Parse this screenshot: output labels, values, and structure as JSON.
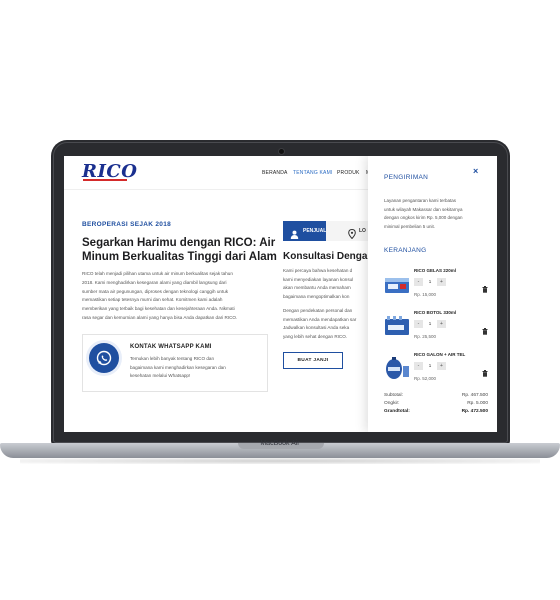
{
  "device": {
    "label": "MacBook Air"
  },
  "site": {
    "logo": "RICO",
    "nav": [
      "BERANDA",
      "TENTANG KAMI",
      "PRODUK",
      "M"
    ],
    "active_nav": 1
  },
  "about": {
    "eyebrow": "BEROPERASI SEJAK 2018",
    "headline_line1": "Segarkan Harimu dengan RICO: Air",
    "headline_line2": "Minum Berkualitas Tinggi dari Alam",
    "paragraph_lines": [
      "RICO telah menjadi pilihan utama untuk air minum berkualitas sejak tahun",
      "2018. Kami menghadirkan kesegaran alami yang diambil langsung dari",
      "sumber mata air pegunungan, diproses dengan teknologi canggih untuk",
      "memastikan setiap tetesnya murni dan sehat. Komitmen kami adalah",
      "memberikan yang terbaik bagi kesehatan dan kesejahteraan Anda. Nikmati",
      "rasa segar dan kemurnian alami yang hanya bisa Anda dapatkan dari RICO."
    ],
    "whatsapp": {
      "title": "KONTAK WHATSAPP KAMI",
      "desc_lines": [
        "Temukan lebih banyak tentang RICO dan",
        "bagaimana kami menghadirkan kesegaran dan",
        "kesehatan melalui Whatsapp!"
      ]
    }
  },
  "consult": {
    "tab1": "PENJUALAN",
    "tab2": "LO",
    "title": "Konsultasi Dengan S",
    "para1_lines": [
      "Kami percaya bahwa kesehatan d",
      "kami menyediakan layanan konsul",
      "akan membantu Anda memaham",
      "bagaimana mengoptimalkan kon"
    ],
    "para2_lines": [
      "Dengan pendekatan personal dan",
      "memastikan Anda mendapatkan sar",
      "Jadwalkan konsultasi Anda seka",
      "yang lebih sehat dengan RICO."
    ],
    "button": "BUAT JANJI"
  },
  "cart_panel": {
    "close": "×",
    "shipping_title": "PENGIRIMAN",
    "shipping_lines": [
      "Layanan pengantaran kami terbatas",
      "untuk wilayah Makassar dan sekitarnya",
      "dengan ongkos kirim Rp. 5,000 dengan",
      "minimal pembelian 5 unit."
    ],
    "cart_title": "KERANJANG",
    "items": [
      {
        "name": "RICO GELAS 220ml",
        "qty": "1",
        "price": "Rp. 15,000",
        "minus": "-",
        "plus": "+"
      },
      {
        "name": "RICO BOTOL 330ml",
        "qty": "1",
        "price": "Rp. 25,500",
        "minus": "-",
        "plus": "+"
      },
      {
        "name": "RICO GALON + AIR TEL",
        "qty": "1",
        "price": "Rp. 52,000",
        "minus": "-",
        "plus": "+"
      }
    ],
    "summary": [
      {
        "label": "Subtotal:",
        "value": "Rp. 467.500"
      },
      {
        "label": "Ongkir:",
        "value": "Rp. 5.000"
      },
      {
        "label": "Grandtotal:",
        "value": "Rp. 472.500"
      }
    ]
  },
  "colors": {
    "brand": "#1f4fa0",
    "accent_red": "#d42a2a"
  }
}
